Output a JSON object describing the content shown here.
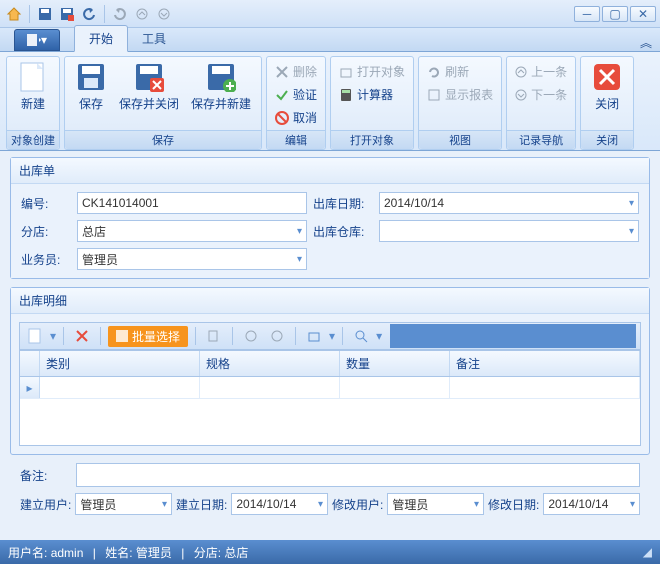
{
  "tabs": {
    "start": "开始",
    "tools": "工具"
  },
  "ribbon": {
    "new": "新建",
    "group_new": "对象创建",
    "save": "保存",
    "save_close": "保存并关闭",
    "save_new": "保存并新建",
    "group_save": "保存",
    "delete": "删除",
    "validate": "验证",
    "cancel": "取消",
    "group_edit": "编辑",
    "open_obj": "打开对象",
    "calculator": "计算器",
    "group_open": "打开对象",
    "refresh": "刷新",
    "show_report": "显示报表",
    "group_view": "视图",
    "prev": "上一条",
    "next": "下一条",
    "group_nav": "记录导航",
    "close": "关闭",
    "group_close": "关闭"
  },
  "form": {
    "panel_title": "出库单",
    "code_label": "编号:",
    "code_value": "CK141014001",
    "date_label": "出库日期:",
    "date_value": "2014/10/14",
    "branch_label": "分店:",
    "branch_value": "总店",
    "warehouse_label": "出库仓库:",
    "warehouse_value": "",
    "staff_label": "业务员:",
    "staff_value": "管理员"
  },
  "detail": {
    "panel_title": "出库明细",
    "bulk_select": "批量选择",
    "columns": {
      "category": "类别",
      "spec": "规格",
      "qty": "数量",
      "remark": "备注"
    }
  },
  "remarks_label": "备注:",
  "footer": {
    "create_user_label": "建立用户:",
    "create_user": "管理员",
    "create_date_label": "建立日期:",
    "create_date": "2014/10/14",
    "modify_user_label": "修改用户:",
    "modify_user": "管理员",
    "modify_date_label": "修改日期:",
    "modify_date": "2014/10/14"
  },
  "status": {
    "username_label": "用户名:",
    "username": "admin",
    "name_label": "姓名:",
    "name": "管理员",
    "branch_label": "分店:",
    "branch": "总店"
  }
}
